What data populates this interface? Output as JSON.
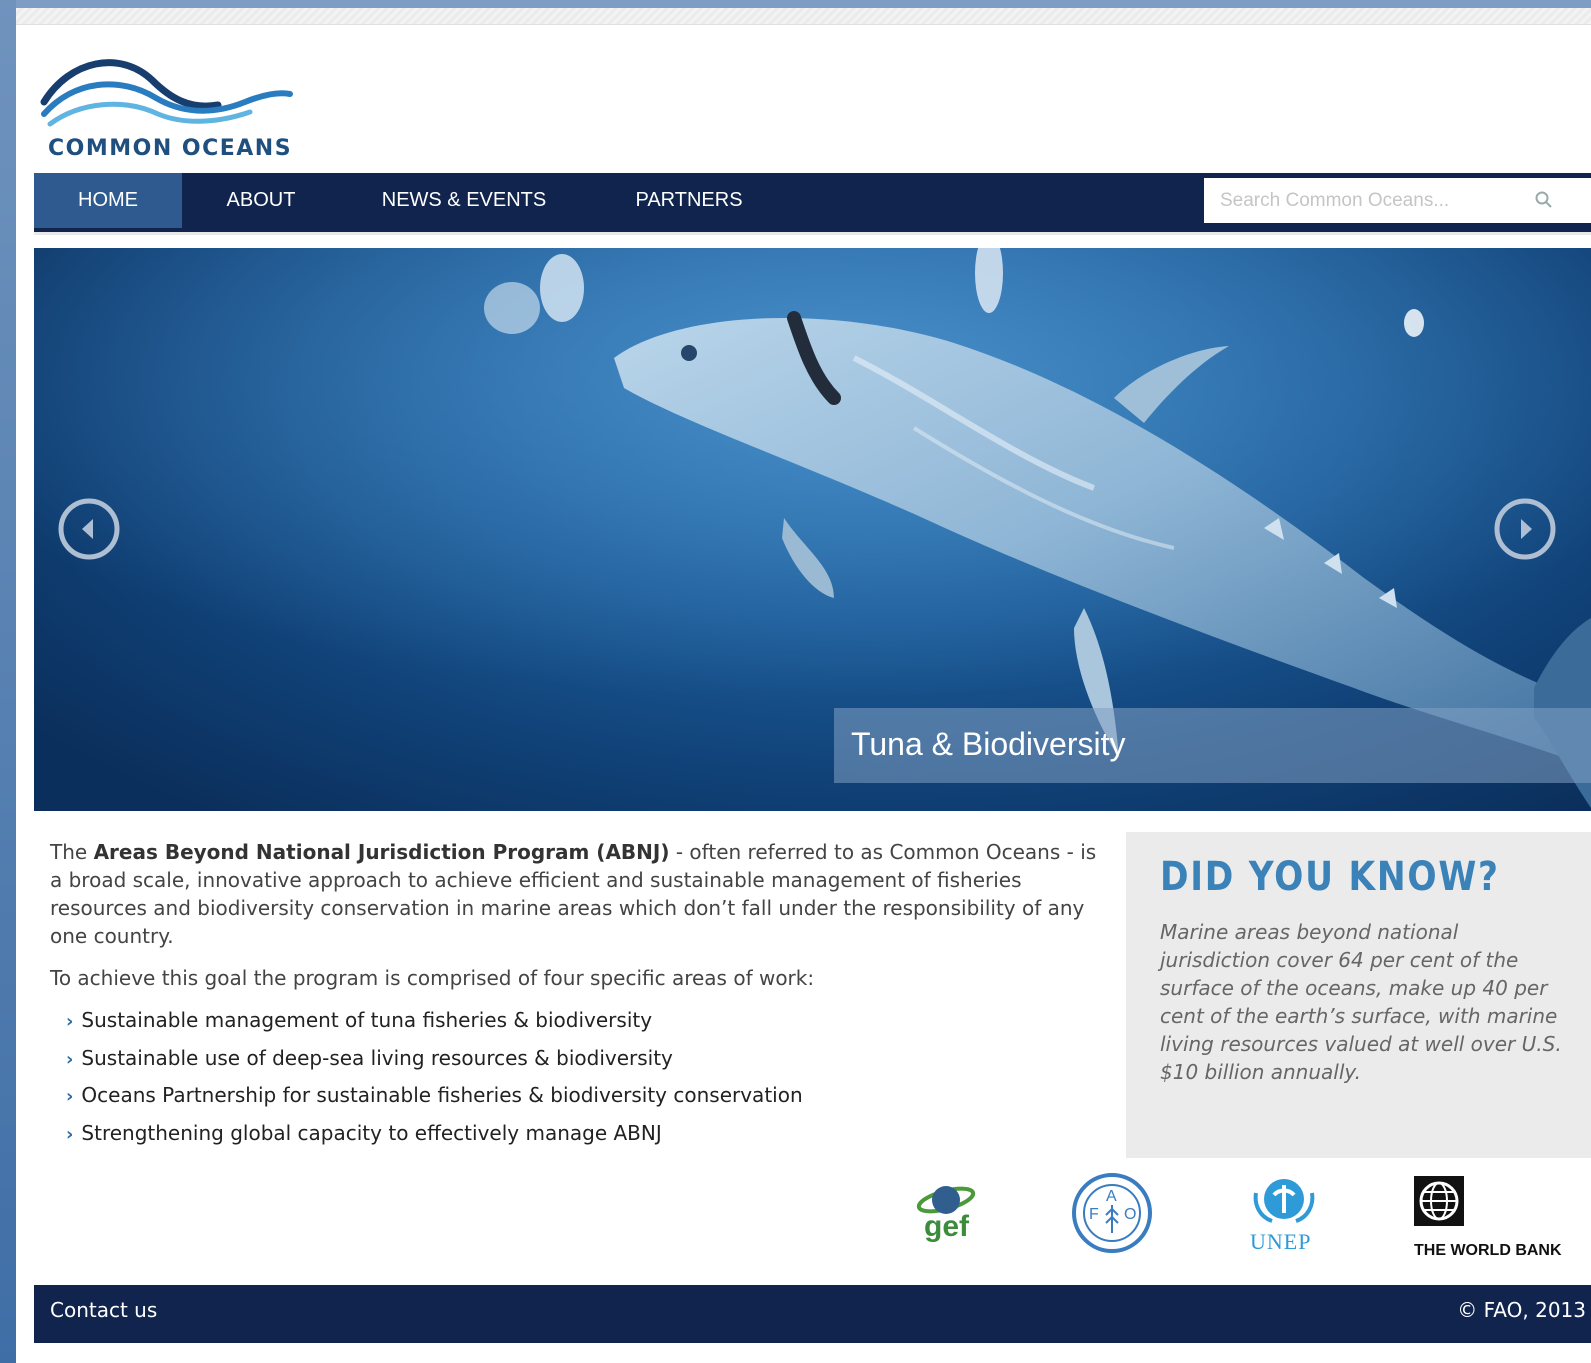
{
  "brand": {
    "name": "COMMON OCEANS"
  },
  "nav": {
    "items": [
      {
        "label": "HOME",
        "active": true
      },
      {
        "label": "ABOUT",
        "active": false
      },
      {
        "label": "NEWS & EVENTS",
        "active": false
      },
      {
        "label": "PARTNERS",
        "active": false
      }
    ]
  },
  "search": {
    "placeholder": "Search Common Oceans...",
    "icon": "search-icon"
  },
  "hero": {
    "caption": "Tuna & Biodiversity",
    "prev_icon": "circle-chevron-left-icon",
    "next_icon": "circle-chevron-right-icon"
  },
  "intro": {
    "p1_before": "The ",
    "p1_bold": "Areas Beyond National Jurisdiction Program (ABNJ)",
    "p1_after": " - often referred to as Common Oceans - is a broad scale, innovative approach to achieve efficient and sustainable management of fisheries resources and biodiversity conservation in marine areas which don’t fall under the responsibility of any one country.",
    "p2": "To achieve this goal the program is comprised of four specific areas of work:",
    "bullets": [
      "Sustainable management of tuna fisheries & biodiversity",
      "Sustainable use of deep-sea living resources & biodiversity",
      "Oceans Partnership for sustainable fisheries & biodiversity conservation",
      "Strengthening global capacity to effectively manage ABNJ"
    ]
  },
  "did_you_know": {
    "title": "DID YOU KNOW?",
    "text": "Marine areas beyond national jurisdiction cover 64 per cent of the surface of the oceans, make up 40 per cent of the earth’s surface, with marine living resources valued at well over U.S. $10 billion annually."
  },
  "partners": {
    "gef": "gef",
    "unep": "UNEP",
    "worldbank": "THE WORLD BANK"
  },
  "footer": {
    "contact": "Contact us",
    "copyright": "© FAO, 2013"
  },
  "colors": {
    "nav_bg": "#10244d",
    "nav_active": "#2f5a8f",
    "accent": "#3a82b8"
  }
}
